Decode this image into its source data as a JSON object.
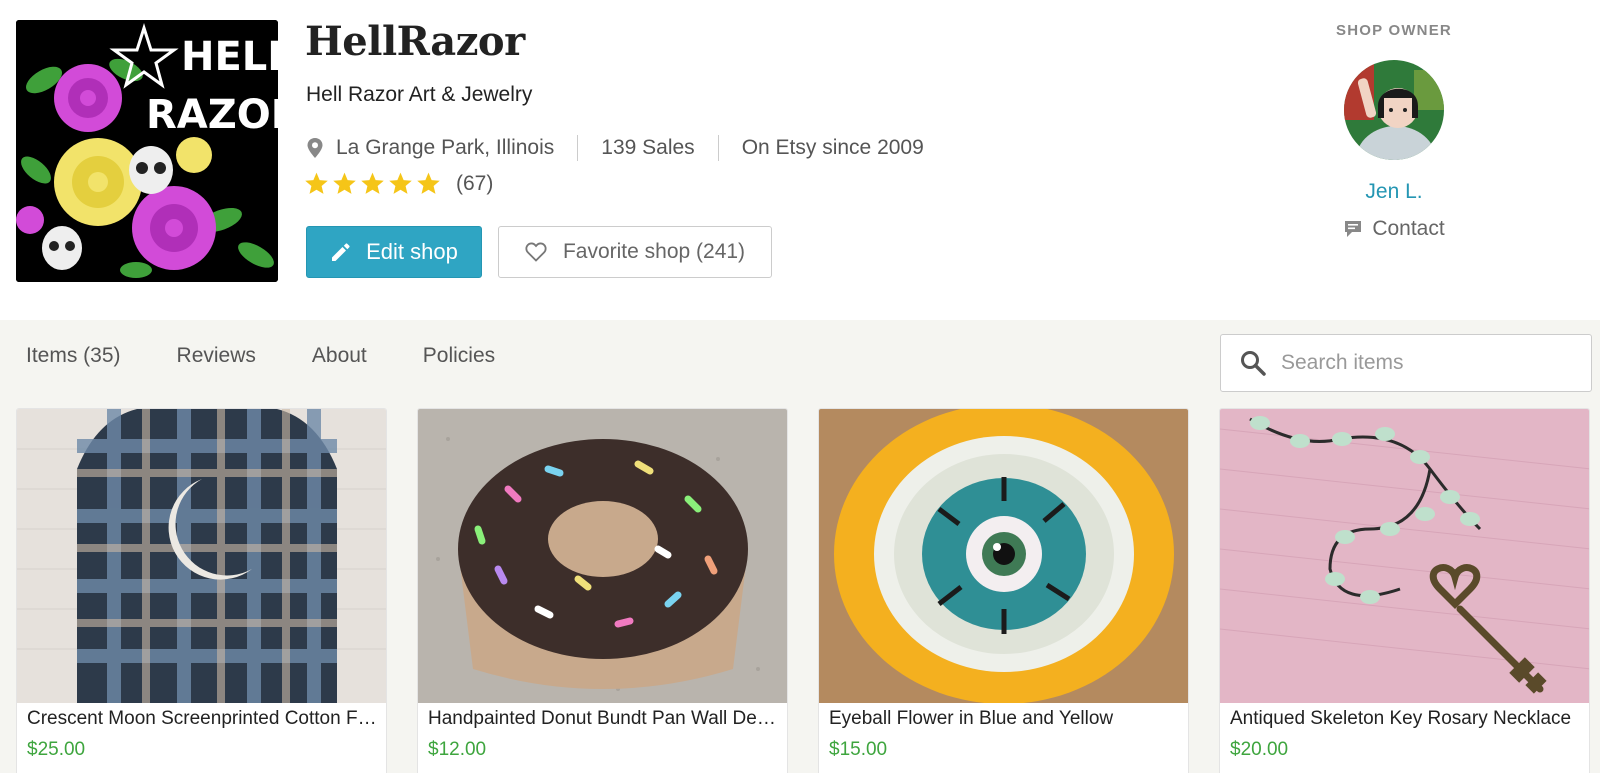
{
  "shop": {
    "name": "HellRazor",
    "tagline": "Hell Razor Art & Jewelry",
    "location": "La Grange Park, Illinois",
    "sales": "139 Sales",
    "since": "On Etsy since 2009",
    "rating_stars": 5,
    "review_count": "(67)",
    "logo_text_1": "HELL",
    "logo_text_2": "RAZOR"
  },
  "actions": {
    "edit_label": "Edit shop",
    "favorite_label": "Favorite shop (241)"
  },
  "owner": {
    "heading": "SHOP OWNER",
    "name": "Jen L.",
    "contact_label": "Contact"
  },
  "tabs": [
    {
      "label": "Items (35)"
    },
    {
      "label": "Reviews"
    },
    {
      "label": "About"
    },
    {
      "label": "Policies"
    }
  ],
  "search": {
    "placeholder": "Search items"
  },
  "listings": [
    {
      "title": "Crescent Moon Screenprinted Cotton Flannel Shirt",
      "price": "$25.00"
    },
    {
      "title": "Handpainted Donut Bundt Pan Wall Decor",
      "price": "$12.00"
    },
    {
      "title": "Eyeball Flower in Blue and Yellow",
      "price": "$15.00"
    },
    {
      "title": "Antiqued Skeleton Key Rosary Necklace",
      "price": "$20.00"
    }
  ],
  "colors": {
    "accent": "#2fa5c3",
    "link": "#2496b3",
    "price": "#3ea53e",
    "star": "#f5c518",
    "section_bg": "#f5f5f1"
  }
}
